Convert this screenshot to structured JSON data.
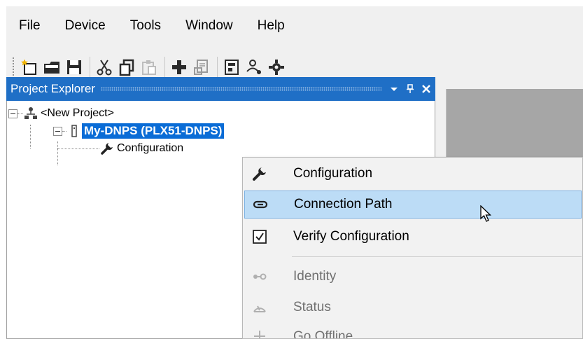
{
  "menubar": {
    "items": [
      "File",
      "Device",
      "Tools",
      "Window",
      "Help"
    ]
  },
  "toolbar": {
    "buttons": [
      "new-project-icon",
      "open-folder-icon",
      "save-icon",
      "cut-icon",
      "copy-icon",
      "paste-icon",
      "add-icon",
      "properties-icon",
      "module-icon",
      "network-icon",
      "settings-icon"
    ]
  },
  "project_explorer": {
    "title": "Project Explorer",
    "pin_glyph": "↓",
    "close_glyph": "×",
    "tree": {
      "root": "<New Project>",
      "device": "My-DNPS (PLX51-DNPS)",
      "child": "Configuration"
    }
  },
  "context_menu": {
    "items": [
      {
        "label": "Configuration",
        "icon": "wrench-icon",
        "enabled": true
      },
      {
        "label": "Connection Path",
        "icon": "link-icon",
        "enabled": true,
        "highlighted": true
      },
      {
        "label": "Verify Configuration",
        "icon": "checkbox-icon",
        "enabled": true
      },
      {
        "label": "Identity",
        "icon": "identity-icon",
        "enabled": false
      },
      {
        "label": "Status",
        "icon": "gauge-icon",
        "enabled": false
      },
      {
        "label": "Go Offline",
        "icon": "offline-icon",
        "enabled": false
      }
    ]
  },
  "colors": {
    "panel_header": "#1f6fc6",
    "selection": "#0a6cd6",
    "menu_hover": "#bcdcf6",
    "workarea": "#a6a6a6"
  }
}
